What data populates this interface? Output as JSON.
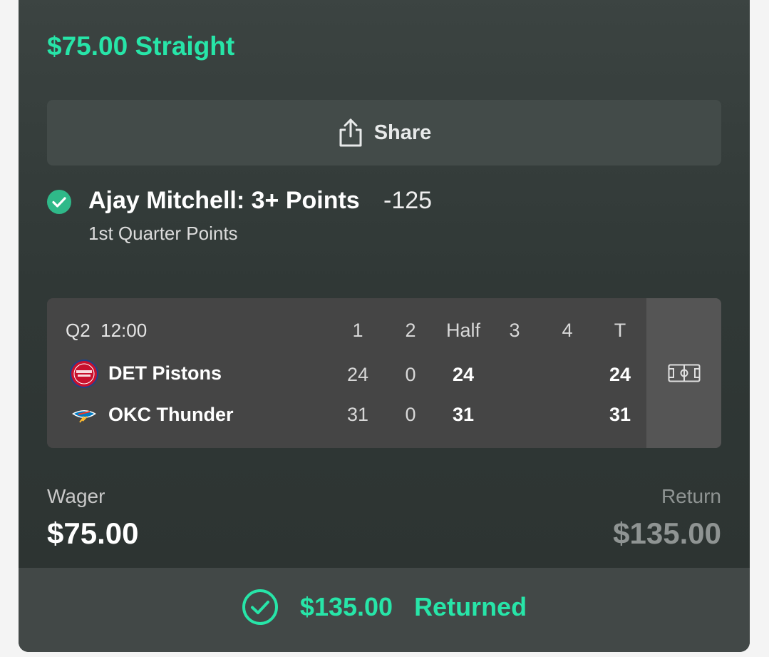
{
  "bet": {
    "title": "$75.00 Straight"
  },
  "share": {
    "label": "Share"
  },
  "selection": {
    "name": "Ajay Mitchell: 3+ Points",
    "odds": "-125",
    "market": "1st Quarter Points"
  },
  "scoreboard": {
    "period": "Q2",
    "clock": "12:00",
    "headers": [
      "1",
      "2",
      "Half",
      "3",
      "4",
      "T"
    ],
    "teams": [
      {
        "name": "DET Pistons",
        "scores": [
          "24",
          "0",
          "24",
          "",
          "",
          "24"
        ]
      },
      {
        "name": "OKC Thunder",
        "scores": [
          "31",
          "0",
          "31",
          "",
          "",
          "31"
        ]
      }
    ]
  },
  "wager": {
    "label": "Wager",
    "value": "$75.00"
  },
  "return": {
    "label": "Return",
    "value": "$135.00"
  },
  "footer": {
    "amount": "$135.00",
    "status": "Returned"
  },
  "colors": {
    "accent": "#27e5a8",
    "card": "#343b39",
    "scoreboard": "#454545"
  },
  "icons": {
    "share": "share-icon",
    "check": "check-circle-icon",
    "court": "court-icon",
    "returned": "check-circle-outline-icon"
  }
}
